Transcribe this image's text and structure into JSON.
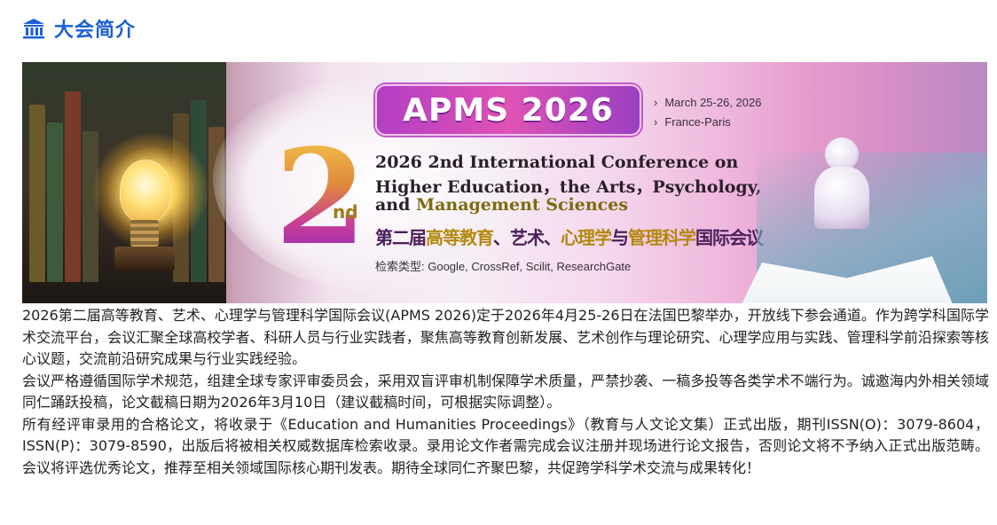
{
  "section": {
    "icon": "museum-icon",
    "title": "大会简介"
  },
  "banner": {
    "acronym": "APMS 2026",
    "date": "March 25-26, 2026",
    "location": "France-Paris",
    "ordinal_number": "2",
    "ordinal_suffix": "nd",
    "title_line1": "2026 2nd International Conference on",
    "title_line2": "Higher Education，the Arts，Psychology,",
    "title_line3_prefix": "and ",
    "title_line3_rest": "Management Sciences",
    "cn_name_part1": "第二届",
    "cn_name_part2": "高等教育",
    "cn_name_part3": "、艺术、",
    "cn_name_part4": "心理学",
    "cn_name_part5": "与",
    "cn_name_part6": "管理科学",
    "cn_name_part7": "国际会议",
    "index_types": "检索类型: Google, CrossRef, Scilit, ResearchGate"
  },
  "paragraphs": [
    "2026第二届高等教育、艺术、心理学与管理科学国际会议(APMS 2026)定于2026年4月25-26日在法国巴黎举办，开放线下参会通道。作为跨学科国际学术交流平台，会议汇聚全球高校学者、科研人员与行业实践者，聚焦高等教育创新发展、艺术创作与理论研究、心理学应用与实践、管理科学前沿探索等核心议题，交流前沿研究成果与行业实践经验。",
    "会议严格遵循国际学术规范，组建全球专家评审委员会，采用双盲评审机制保障学术质量，严禁抄袭、一稿多投等各类学术不端行为。诚邀海内外相关领域同仁踊跃投稿，论文截稿日期为2026年3月10日（建议截稿时间，可根据实际调整）。",
    "所有经评审录用的合格论文，将收录于《Education and Humanities Proceedings》（教育与人文论文集）正式出版，期刊ISSN(O)：3079-8604，ISSN(P)：3079-8590，出版后将被相关权威数据库检索收录。录用论文作者需完成会议注册并现场进行论文报告，否则论文将不予纳入正式出版范畴。会议将评选优秀论文，推荐至相关领域国际核心期刊发表。期待全球同仁齐聚巴黎，共促跨学科学术交流与成果转化！"
  ],
  "colors": {
    "title_blue": "#1a5fd9",
    "banner_purple": "#b23ec4",
    "olive_gold": "#7d6a10"
  }
}
